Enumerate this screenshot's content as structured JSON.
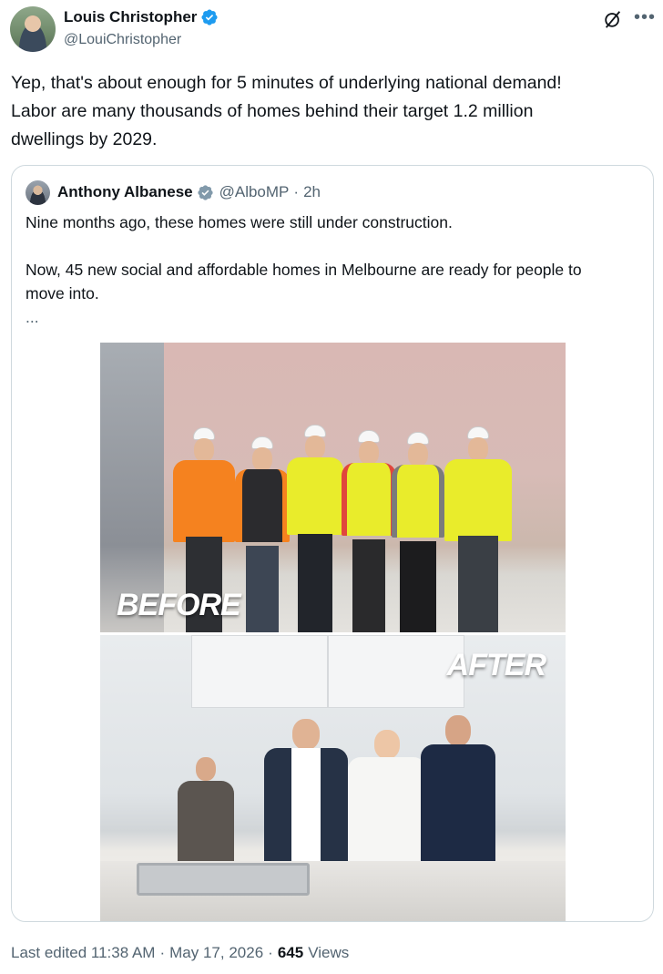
{
  "author": {
    "name": "Louis Christopher",
    "handle": "@LouiChristopher"
  },
  "tweet": {
    "lines": [
      "Yep, that's about enough for 5 minutes of underlying national demand!",
      "Labor are many thousands of homes behind their target 1.2 million",
      "dwellings by 2029."
    ]
  },
  "quote": {
    "name": "Anthony Albanese",
    "handle": "@AlboMP",
    "dot": "·",
    "time": "2h",
    "line1": "Nine months ago, these homes were still under construction.",
    "line2": "Now, 45 new social and affordable homes in Melbourne are ready for people to",
    "line3": "move into.",
    "ellipsis": "...",
    "before_label": "BEFORE",
    "after_label": "AFTER"
  },
  "footer": {
    "edited": "Last edited 11:38 AM",
    "date": "May 17, 2026",
    "dot": "·",
    "views_count": "645",
    "views_label": "Views"
  },
  "colors": {
    "verified": "#1d9bf0",
    "muted": "#536471",
    "text": "#0f1419",
    "hi_vis_yellow": "#e9ec2b",
    "hi_vis_orange": "#f5821f"
  },
  "icons": [
    "verified-badge-icon",
    "grok-icon",
    "more-icon"
  ]
}
